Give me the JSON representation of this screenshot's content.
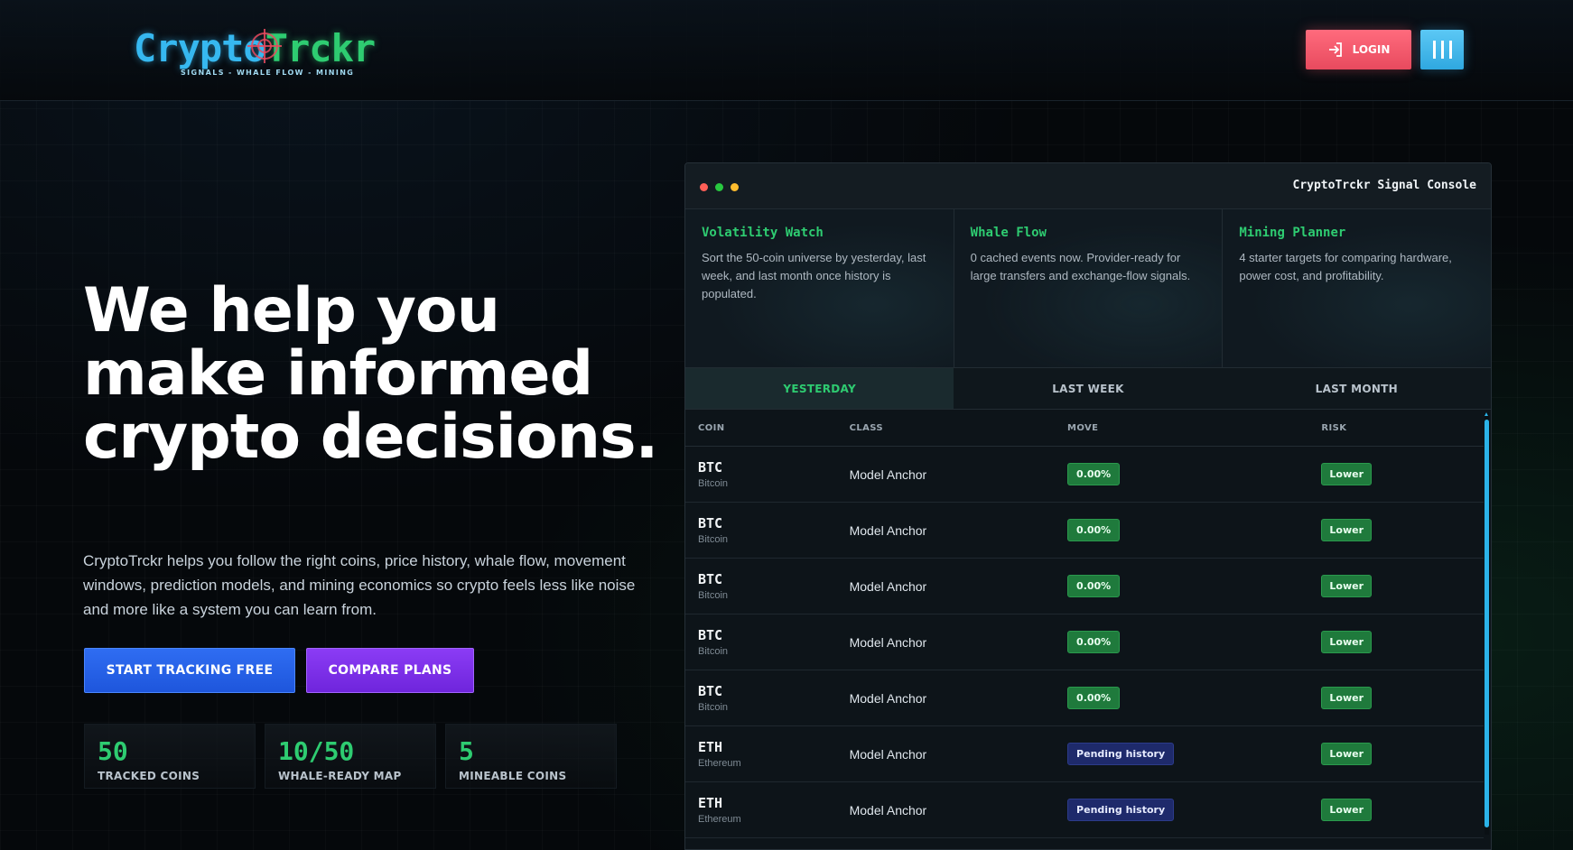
{
  "header": {
    "logo_part1": "Crypto",
    "logo_part2": "Trckr",
    "logo_tagline": "SIGNALS - WHALE FLOW - MINING",
    "login_label": "LOGIN"
  },
  "hero": {
    "title": "We help you make informed crypto decisions.",
    "description": "CryptoTrckr helps you follow the right coins, price history, whale flow, movement windows, prediction models, and mining economics so crypto feels less like noise and more like a system you can learn from.",
    "cta_primary": "START TRACKING FREE",
    "cta_secondary": "COMPARE PLANS"
  },
  "stats": [
    {
      "value": "50",
      "label": "TRACKED COINS"
    },
    {
      "value": "10/50",
      "label": "WHALE-READY MAP"
    },
    {
      "value": "5",
      "label": "MINEABLE COINS"
    }
  ],
  "console": {
    "title": "CryptoTrckr Signal Console",
    "dot_colors": [
      "#ff5f57",
      "#28c840",
      "#febc2e"
    ],
    "cards": [
      {
        "title": "Volatility Watch",
        "text": "Sort the 50-coin universe by yesterday, last week, and last month once history is populated."
      },
      {
        "title": "Whale Flow",
        "text": "0 cached events now. Provider-ready for large transfers and exchange-flow signals."
      },
      {
        "title": "Mining Planner",
        "text": "4 starter targets for comparing hardware, power cost, and profitability."
      }
    ],
    "tabs": [
      {
        "label": "YESTERDAY",
        "active": true
      },
      {
        "label": "LAST WEEK",
        "active": false
      },
      {
        "label": "LAST MONTH",
        "active": false
      }
    ],
    "columns": [
      "COIN",
      "CLASS",
      "MOVE",
      "RISK"
    ],
    "rows": [
      {
        "symbol": "BTC",
        "name": "Bitcoin",
        "class": "Model Anchor",
        "move": "0.00%",
        "move_type": "green",
        "risk": "Lower"
      },
      {
        "symbol": "BTC",
        "name": "Bitcoin",
        "class": "Model Anchor",
        "move": "0.00%",
        "move_type": "green",
        "risk": "Lower"
      },
      {
        "symbol": "BTC",
        "name": "Bitcoin",
        "class": "Model Anchor",
        "move": "0.00%",
        "move_type": "green",
        "risk": "Lower"
      },
      {
        "symbol": "BTC",
        "name": "Bitcoin",
        "class": "Model Anchor",
        "move": "0.00%",
        "move_type": "green",
        "risk": "Lower"
      },
      {
        "symbol": "BTC",
        "name": "Bitcoin",
        "class": "Model Anchor",
        "move": "0.00%",
        "move_type": "green",
        "risk": "Lower"
      },
      {
        "symbol": "ETH",
        "name": "Ethereum",
        "class": "Model Anchor",
        "move": "Pending history",
        "move_type": "blue",
        "risk": "Lower"
      },
      {
        "symbol": "ETH",
        "name": "Ethereum",
        "class": "Model Anchor",
        "move": "Pending history",
        "move_type": "blue",
        "risk": "Lower"
      }
    ]
  },
  "colors": {
    "accent_green": "#2ecc71",
    "accent_blue": "#36b8f0",
    "login_red": "#ff6b7d",
    "cta_blue": "#2f6df2",
    "cta_purple": "#8b3cf5"
  }
}
